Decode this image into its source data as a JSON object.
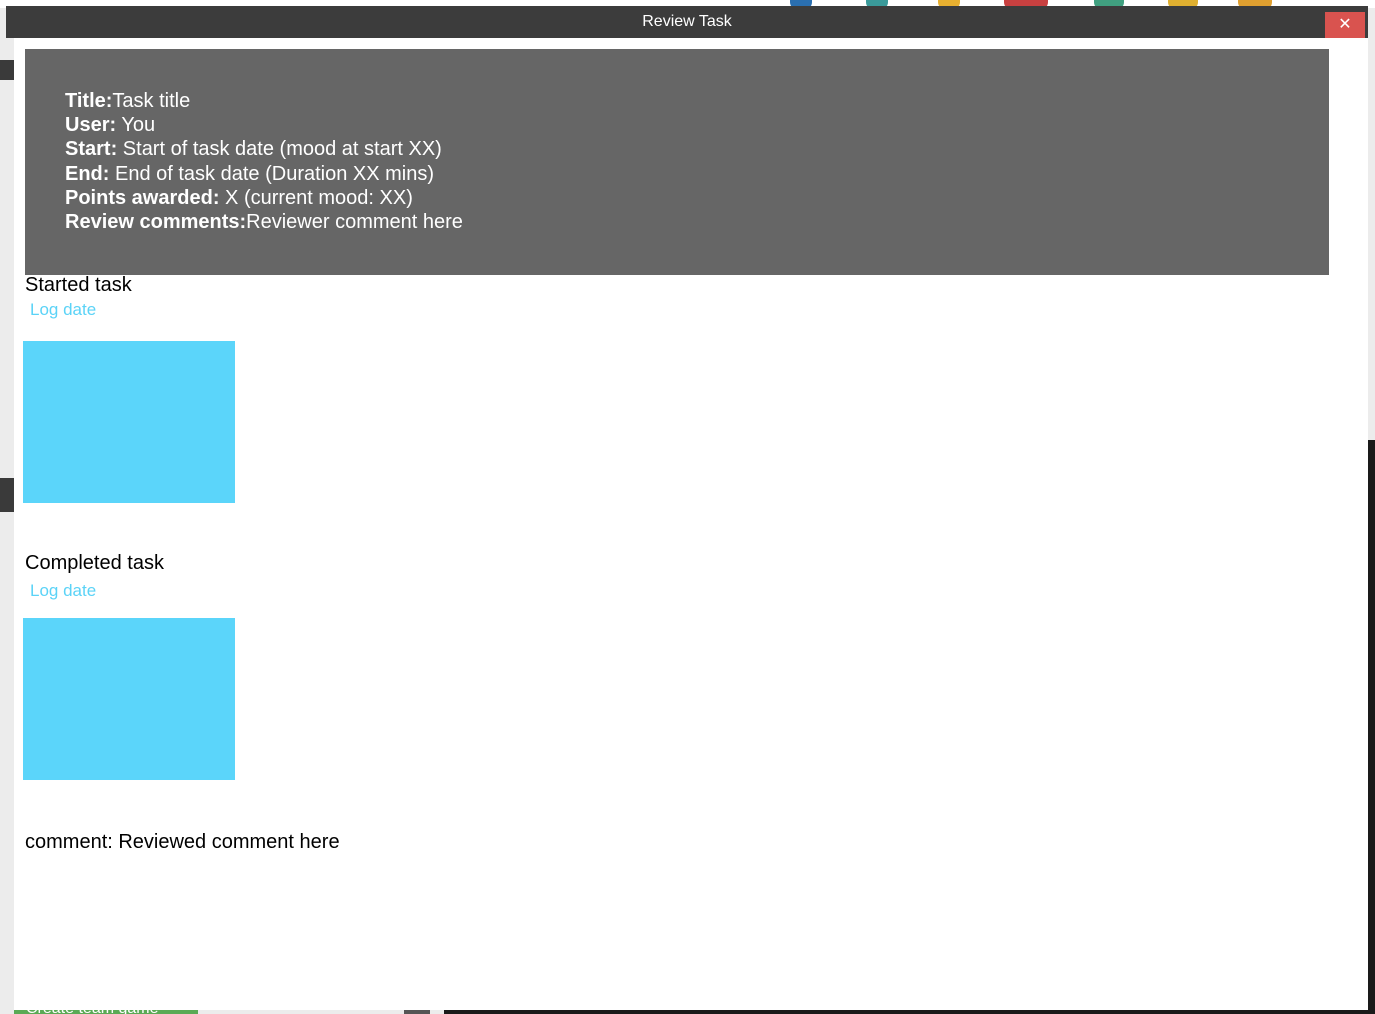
{
  "window": {
    "title": "Review Task",
    "close_label": "✕"
  },
  "summary": {
    "title_label": "Title:",
    "title_value": "Task title",
    "user_label": "User:",
    "user_value": " You",
    "start_label": "Start:",
    "start_value": " Start of task date (mood at start XX)",
    "end_label": "End:",
    "end_value": " End of task date (Duration XX mins)",
    "points_label": "Points awarded:",
    "points_value": " X (current mood: XX)",
    "review_label": "Review comments:",
    "review_value": "Reviewer comment here"
  },
  "log": [
    {
      "heading": "Started task",
      "date_link": "Log date"
    },
    {
      "heading": "Completed task",
      "date_link": "Log date"
    }
  ],
  "comment": "comment: Reviewed comment here",
  "background": {
    "button_label": "Create team game"
  },
  "colors": {
    "summary_bg": "#666666",
    "link": "#5bd3f7",
    "photo_placeholder": "#5bd5fa",
    "close_button": "#d9534f",
    "titlebar": "#3c3c3c"
  }
}
